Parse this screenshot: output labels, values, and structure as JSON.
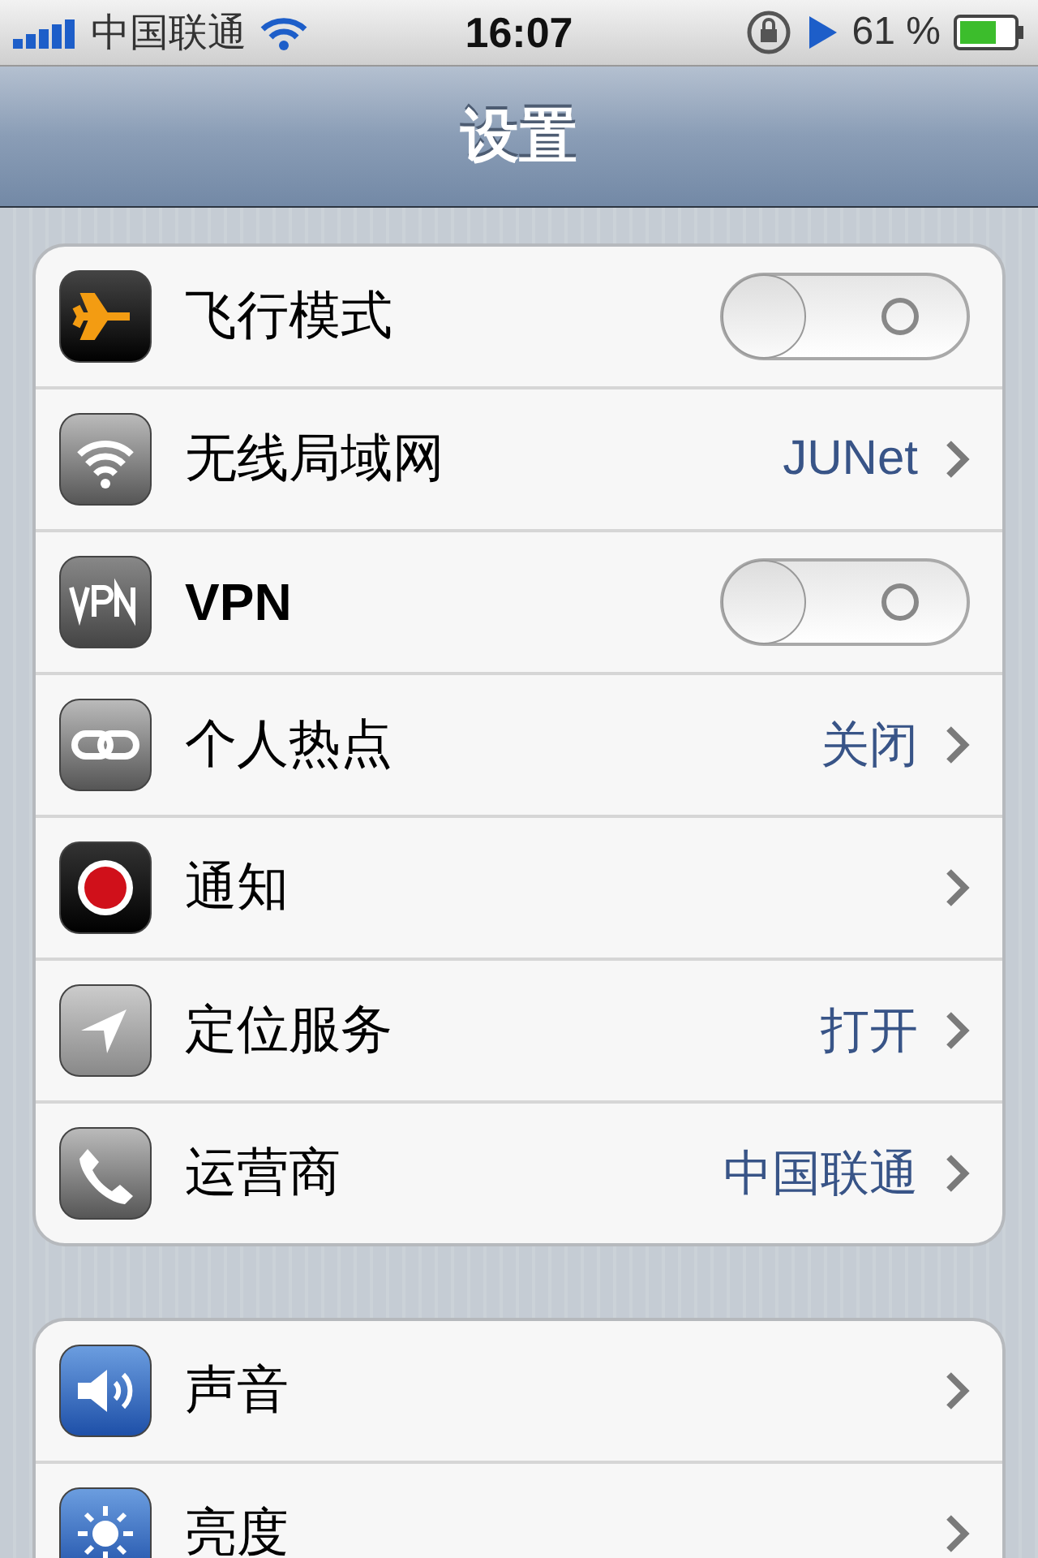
{
  "status_bar": {
    "carrier": "中国联通",
    "time": "16:07",
    "battery": "61 %"
  },
  "nav_bar": {
    "title": "设置"
  },
  "groups": [
    {
      "items": [
        {
          "label": "飞行模式",
          "kind": "toggle",
          "on": false
        },
        {
          "label": "无线局域网",
          "kind": "link",
          "value": "JUNet"
        },
        {
          "label": "VPN",
          "kind": "toggle",
          "on": false
        },
        {
          "label": "个人热点",
          "kind": "link",
          "value": "关闭"
        },
        {
          "label": "通知",
          "kind": "link"
        },
        {
          "label": "定位服务",
          "kind": "link",
          "value": "打开"
        },
        {
          "label": "运营商",
          "kind": "link",
          "value": "中国联通"
        }
      ]
    },
    {
      "items": [
        {
          "label": "声音",
          "kind": "link"
        },
        {
          "label": "亮度",
          "kind": "link"
        }
      ]
    }
  ]
}
